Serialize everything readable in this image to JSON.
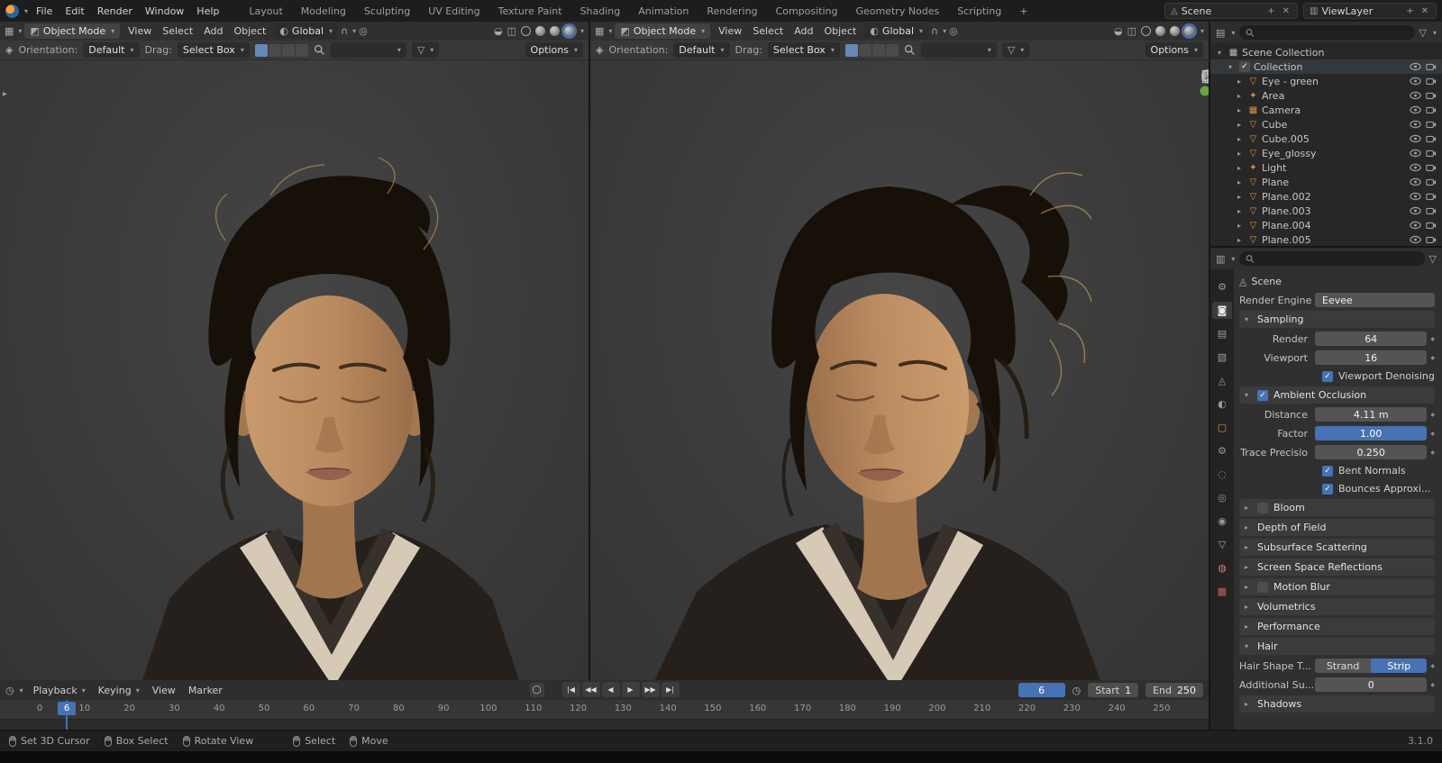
{
  "icons": {
    "dropdown": "▾",
    "expand_open": "▾",
    "expand_closed": "▸",
    "check": "✓",
    "editor_grid": "▦",
    "editor_outliner": "▤",
    "editor_props": "▥",
    "editor_clock": "◷",
    "mode": "◩",
    "globe": "◐",
    "magnet": "∩",
    "proportional": "◎",
    "overlay_a": "◒",
    "overlay_b": "◫",
    "funnel": "▽",
    "scene_glyph": "◬",
    "tool_glyph": "◈",
    "record": "◯",
    "anim_dot": "◆",
    "plus": "+"
  },
  "topbar": {
    "menus": [
      "File",
      "Edit",
      "Render",
      "Window",
      "Help"
    ],
    "workspaces": [
      "Layout",
      "Modeling",
      "Sculpting",
      "UV Editing",
      "Texture Paint",
      "Shading",
      "Animation",
      "Rendering",
      "Compositing",
      "Geometry Nodes",
      "Scripting"
    ],
    "add_workspace": "+",
    "scene_label": "Scene",
    "view_layer_label": "ViewLayer"
  },
  "viewport": {
    "mode": "Object Mode",
    "menus": [
      "View",
      "Select",
      "Add",
      "Object"
    ],
    "orientation": "Global",
    "tool": {
      "orientation_label": "Orientation:",
      "orientation_value": "Default",
      "drag_label": "Drag:",
      "drag_value": "Select Box",
      "options_label": "Options"
    }
  },
  "outliner": {
    "root": "Scene Collection",
    "collection": "Collection",
    "items": [
      {
        "name": "Eye - green",
        "glyph": "▽"
      },
      {
        "name": "Area",
        "glyph": "✦"
      },
      {
        "name": "Camera",
        "glyph": "▦"
      },
      {
        "name": "Cube",
        "glyph": "▽"
      },
      {
        "name": "Cube.005",
        "glyph": "▽"
      },
      {
        "name": "Eye_glossy",
        "glyph": "▽"
      },
      {
        "name": "Light",
        "glyph": "✦"
      },
      {
        "name": "Plane",
        "glyph": "▽"
      },
      {
        "name": "Plane.002",
        "glyph": "▽"
      },
      {
        "name": "Plane.003",
        "glyph": "▽"
      },
      {
        "name": "Plane.004",
        "glyph": "▽"
      },
      {
        "name": "Plane.005",
        "glyph": "▽"
      }
    ]
  },
  "properties": {
    "tabs": [
      {
        "name": "active-tool",
        "glyph": "⚙"
      },
      {
        "name": "render",
        "glyph": "◙"
      },
      {
        "name": "output",
        "glyph": "▤"
      },
      {
        "name": "view-layer",
        "glyph": "▧"
      },
      {
        "name": "scene",
        "glyph": "◬"
      },
      {
        "name": "world",
        "glyph": "◐"
      },
      {
        "name": "object",
        "glyph": "▢"
      },
      {
        "name": "modifiers",
        "glyph": "⚙"
      },
      {
        "name": "particles",
        "glyph": "◌"
      },
      {
        "name": "physics",
        "glyph": "◎"
      },
      {
        "name": "constraints",
        "glyph": "◉"
      },
      {
        "name": "object-data",
        "glyph": "▽"
      },
      {
        "name": "material",
        "glyph": "◍"
      },
      {
        "name": "texture",
        "glyph": "▩"
      }
    ],
    "breadcrumb": "Scene",
    "render_engine_label": "Render Engine",
    "render_engine_value": "Eevee",
    "sampling": {
      "title": "Sampling",
      "render_label": "Render",
      "render_value": "64",
      "viewport_label": "Viewport",
      "viewport_value": "16",
      "denoising_label": "Viewport Denoising"
    },
    "ao": {
      "title": "Ambient Occlusion",
      "distance_label": "Distance",
      "distance_value": "4.11 m",
      "factor_label": "Factor",
      "factor_value": "1.00",
      "trace_label": "Trace Precisio",
      "trace_value": "0.250",
      "bent_label": "Bent Normals",
      "bounces_label": "Bounces Approxi..."
    },
    "collapsed_sections": [
      {
        "label": "Bloom",
        "has_checkbox": true
      },
      {
        "label": "Depth of Field",
        "has_checkbox": false
      },
      {
        "label": "Subsurface Scattering",
        "has_checkbox": false
      },
      {
        "label": "Screen Space Reflections",
        "has_checkbox": false
      },
      {
        "label": "Motion Blur",
        "has_checkbox": true
      },
      {
        "label": "Volumetrics",
        "has_checkbox": false
      },
      {
        "label": "Performance",
        "has_checkbox": false
      }
    ],
    "hair": {
      "title": "Hair",
      "shape_label": "Hair Shape T...",
      "strand": "Strand",
      "strip": "Strip",
      "additional_label": "Additional Su...",
      "additional_value": "0"
    },
    "shadows_title": "Shadows"
  },
  "timeline": {
    "menus": [
      {
        "label": "Playback",
        "caret": true
      },
      {
        "label": "Keying",
        "caret": true
      },
      {
        "label": "View",
        "caret": false
      },
      {
        "label": "Marker",
        "caret": false
      }
    ],
    "transport": [
      "|◀",
      "◀◀",
      "◀",
      "▶",
      "▶▶",
      "▶|"
    ],
    "current_frame": "6",
    "start_label": "Start",
    "start_value": "1",
    "end_label": "End",
    "end_value": "250",
    "ticks": [
      "0",
      "10",
      "20",
      "30",
      "40",
      "50",
      "60",
      "70",
      "80",
      "90",
      "100",
      "110",
      "120",
      "130",
      "140",
      "150",
      "160",
      "170",
      "180",
      "190",
      "200",
      "210",
      "220",
      "230",
      "240",
      "250"
    ]
  },
  "statusbar": {
    "hints_left": [
      "Set 3D Cursor",
      "Box Select",
      "Rotate View"
    ],
    "hints_mid": [
      "Select",
      "Move"
    ],
    "version": "3.1.0"
  },
  "colors": {
    "accent": "#4772b3",
    "object_orange": "#d9913e"
  }
}
